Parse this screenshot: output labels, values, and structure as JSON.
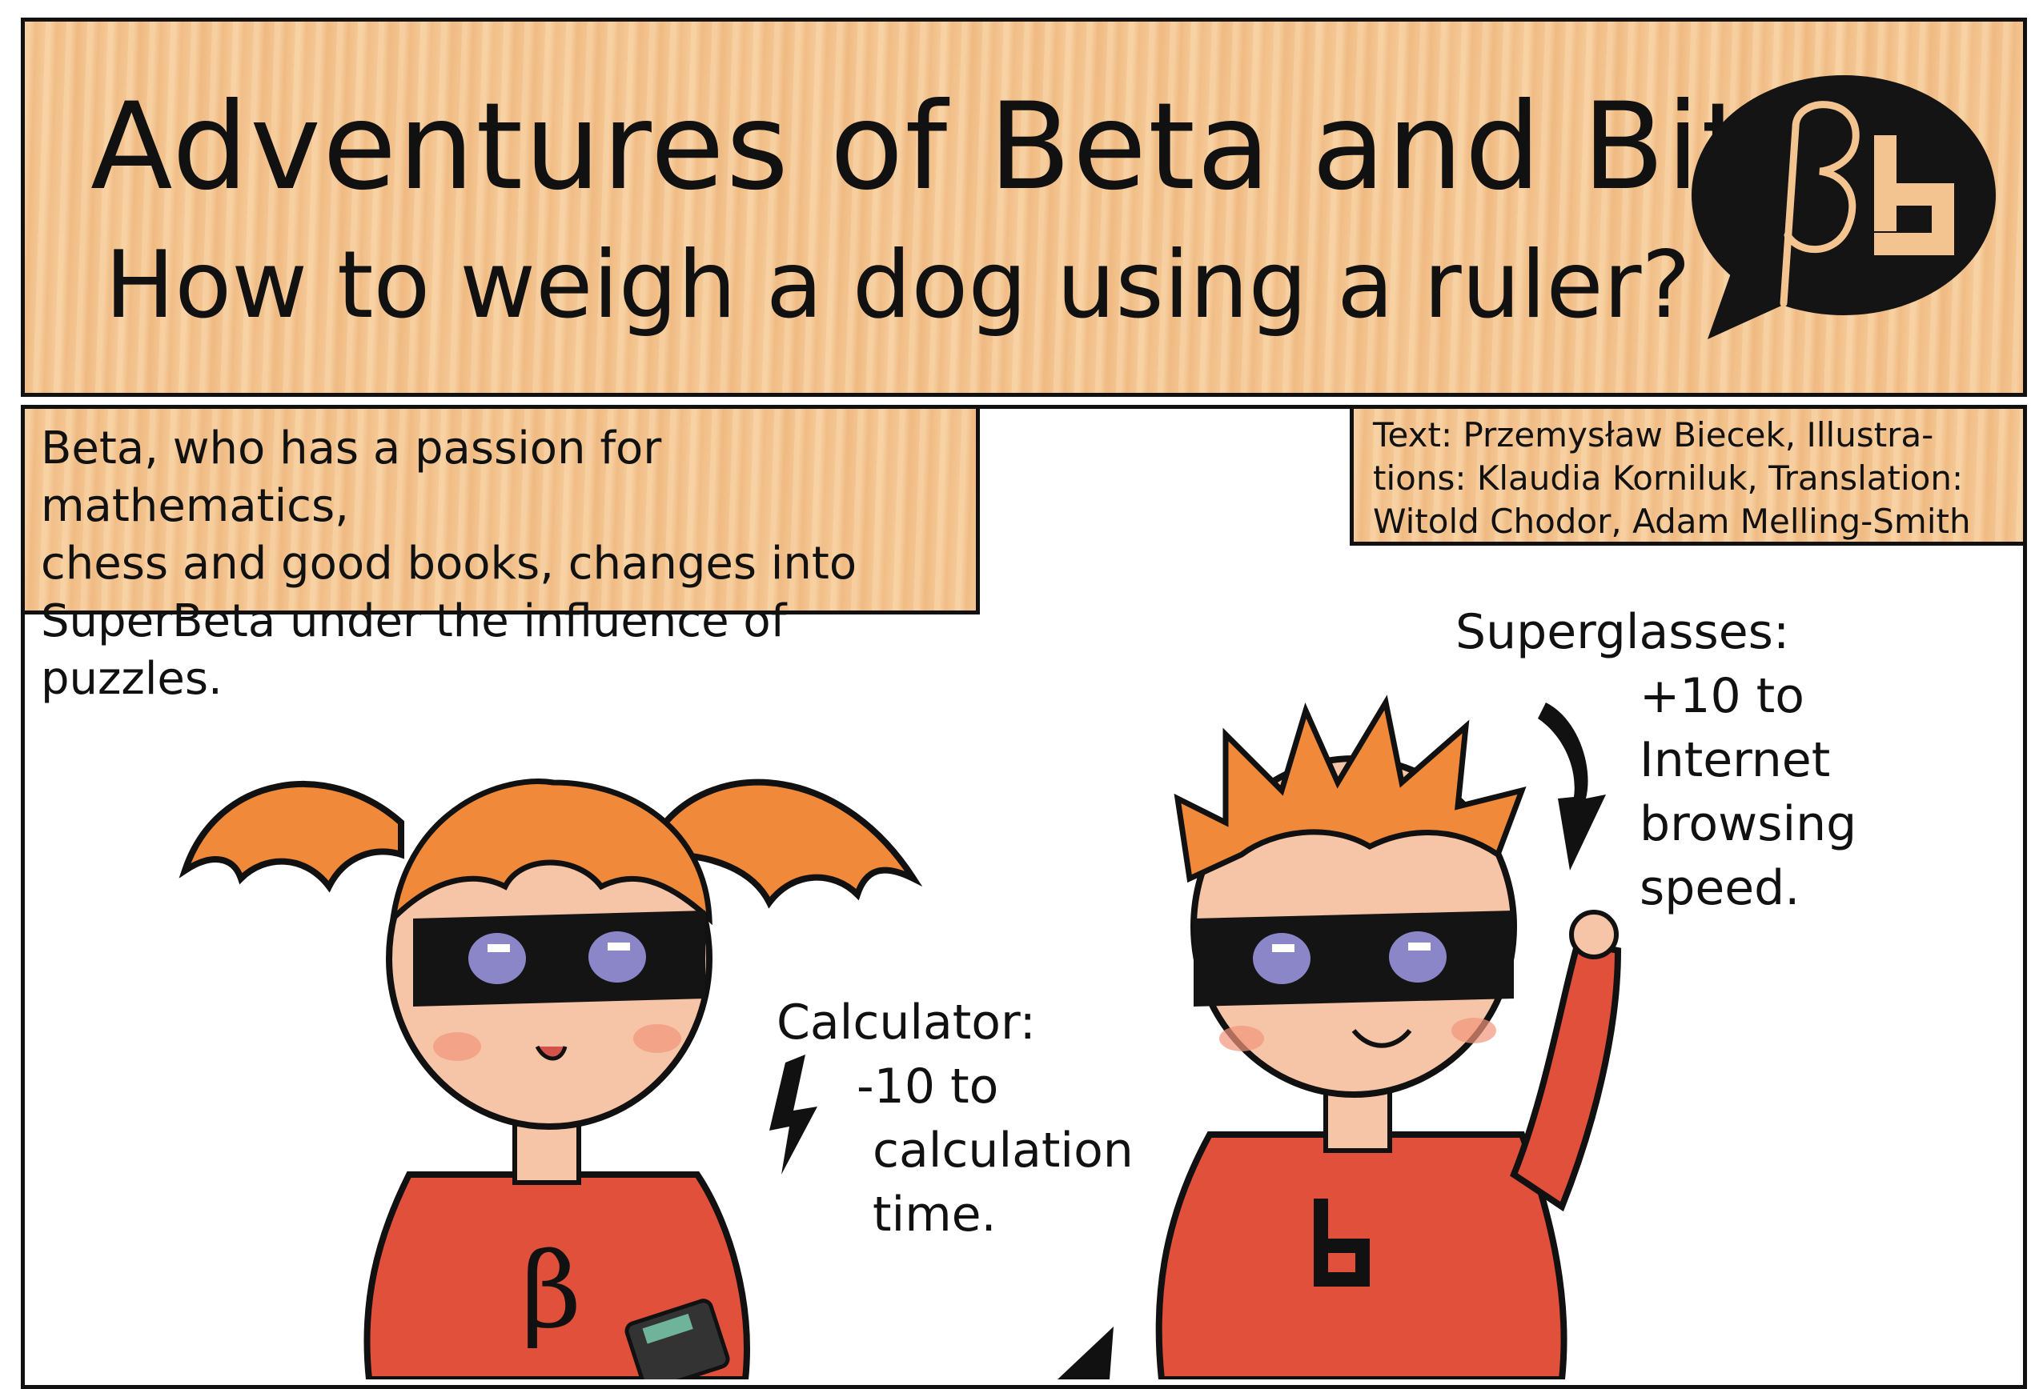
{
  "header": {
    "title": "Adventures of Beta and Bit",
    "subtitle": "How to weigh a dog using a ruler?",
    "logo_letters": "βb"
  },
  "intro": {
    "lines": [
      "Beta, who has a passion for mathematics,",
      "chess and good books, changes into",
      "SuperBeta under the influence of puzzles."
    ]
  },
  "credits": {
    "lines": [
      "Text: Przemysław Biecek,  Illustra-",
      "tions: Klaudia Korniluk, Translation:",
      "Witold Chodor, Adam Melling-Smith"
    ]
  },
  "captions": {
    "superglasses": {
      "label": "Superglasses:",
      "lines": [
        "+10 to",
        "Internet",
        "browsing",
        "speed."
      ]
    },
    "calculator": {
      "label": "Calculator:",
      "line1": "-10 to",
      "line2": "calculation",
      "line3": "time."
    }
  },
  "colors": {
    "wood": "#f3c48f",
    "suit": "#e0503a",
    "hair": "#f08a3a",
    "mask": "#141414",
    "skin": "#f6c4a6"
  }
}
